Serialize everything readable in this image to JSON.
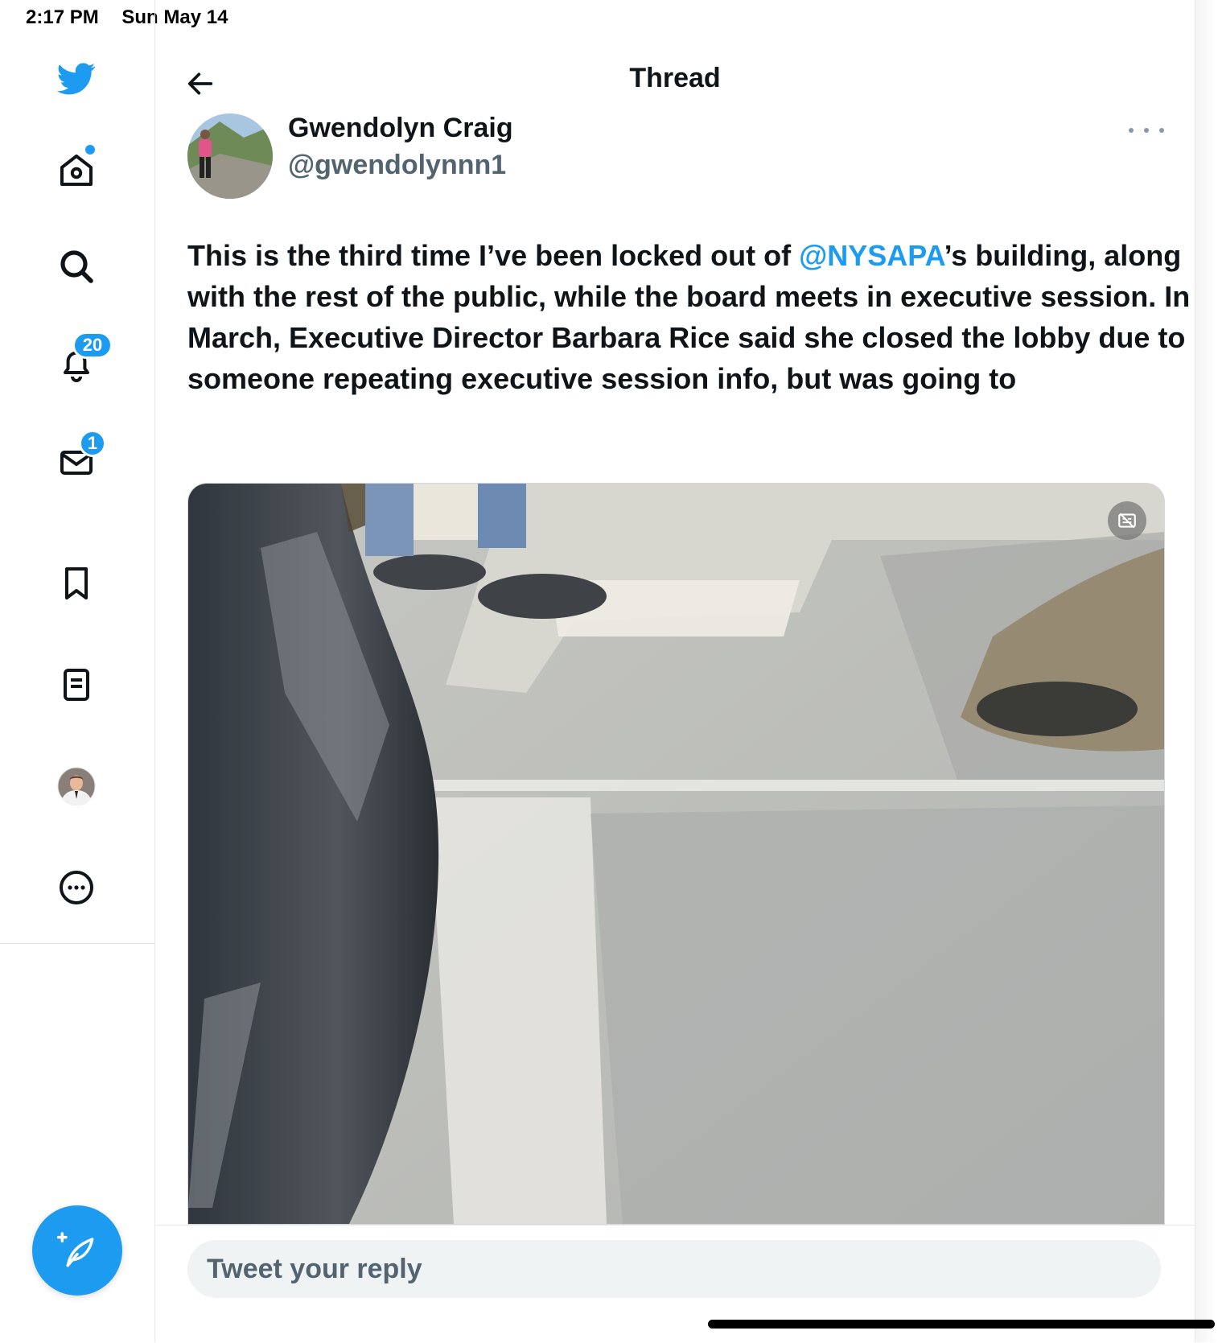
{
  "status_bar": {
    "time": "2:17 PM",
    "date": "Sun May 14"
  },
  "sidebar": {
    "items": [
      {
        "name": "home",
        "icon": "home-icon",
        "has_dot": true
      },
      {
        "name": "explore",
        "icon": "search-icon"
      },
      {
        "name": "notifications",
        "icon": "bell-icon",
        "badge": "20"
      },
      {
        "name": "messages",
        "icon": "mail-icon",
        "badge": "1"
      },
      {
        "name": "bookmarks",
        "icon": "bookmark-icon"
      },
      {
        "name": "lists",
        "icon": "list-icon"
      },
      {
        "name": "profile",
        "icon": "avatar"
      },
      {
        "name": "more",
        "icon": "more-circle-icon"
      }
    ],
    "compose_icon": "compose-tweet-icon"
  },
  "header": {
    "title": "Thread",
    "back_icon": "back-arrow-icon"
  },
  "tweet": {
    "author_name": "Gwendolyn Craig",
    "author_handle": "@gwendolynnn1",
    "text_before": "This is the third time I’ve been locked out of ",
    "mention": "@NYSAPA",
    "text_after": "’s building, along with the rest of the public, while the board meets in executive session. In March, Executive Director Barbara Rice said she closed the lobby due to someone repeating executive session info, but was going to",
    "media_type": "video"
  },
  "reply": {
    "placeholder": "Tweet your reply"
  },
  "colors": {
    "accent": "#1d9bf0",
    "text": "#0f1419",
    "muted": "#536471",
    "reply_bg": "#eff3f4"
  }
}
